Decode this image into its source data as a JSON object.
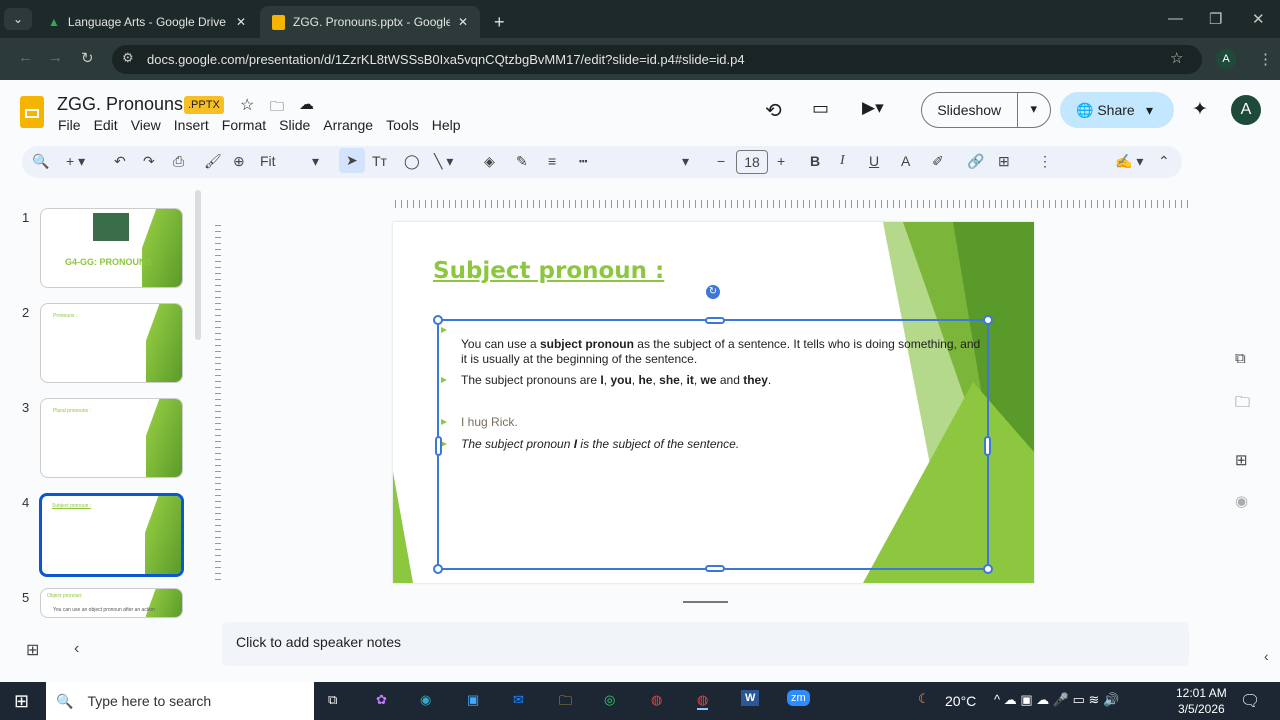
{
  "browser": {
    "tabs": [
      {
        "title": "Language Arts - Google Drive",
        "icon": "google-drive-icon"
      },
      {
        "title": "ZGG. Pronouns.pptx - Google S",
        "icon": "google-slides-icon"
      }
    ],
    "url": "docs.google.com/presentation/d/1ZzrKL8tWSSsB0Ixa5vqnCQtzbgBvMM17/edit?slide=id.p4#slide=id.p4",
    "profile": "A"
  },
  "app": {
    "title": "ZGG. Pronouns",
    "badge": ".PPTX",
    "menu": [
      "File",
      "Edit",
      "View",
      "Insert",
      "Format",
      "Slide",
      "Arrange",
      "Tools",
      "Help"
    ],
    "slideshow": "Slideshow",
    "share": "Share",
    "avatar": "A"
  },
  "toolbar": {
    "zoom": "Fit",
    "font_size": "18"
  },
  "filmstrip": [
    {
      "n": "1",
      "title": "G4-GG: PRONOUNS"
    },
    {
      "n": "2",
      "title": "Pronouns :"
    },
    {
      "n": "3",
      "title": "Plural pronouns :"
    },
    {
      "n": "4",
      "title": "Subject pronoun :"
    },
    {
      "n": "5",
      "title": "Object pronoun:",
      "line": "You can use an object pronoun after an action"
    }
  ],
  "slide": {
    "title": "Subject pronoun :",
    "p1a": "You can use a ",
    "p1b": "subject pronoun",
    "p1c": " as the subject of a sentence. It tells who is doing something, and it is usually at the beginning of the sentence.",
    "p2": [
      "The subject pronouns are ",
      "I",
      ", ",
      "you",
      ", ",
      "he",
      ", ",
      "she",
      ", ",
      "it",
      ", ",
      "we",
      " and ",
      "they",
      "."
    ],
    "ex1": "I hug Rick.",
    "ex2a": "The subject pronoun ",
    "ex2b": "I",
    "ex2c": " is the subject of the sentence."
  },
  "notes": "Click to add speaker notes",
  "taskbar": {
    "search": "Type here to search",
    "weather": "20°C",
    "time": "12:01 AM",
    "date": "3/5/2026"
  },
  "colors": {
    "accent": "#8dc63f",
    "title": "#8dc63f",
    "selection": "#3c78d8"
  }
}
